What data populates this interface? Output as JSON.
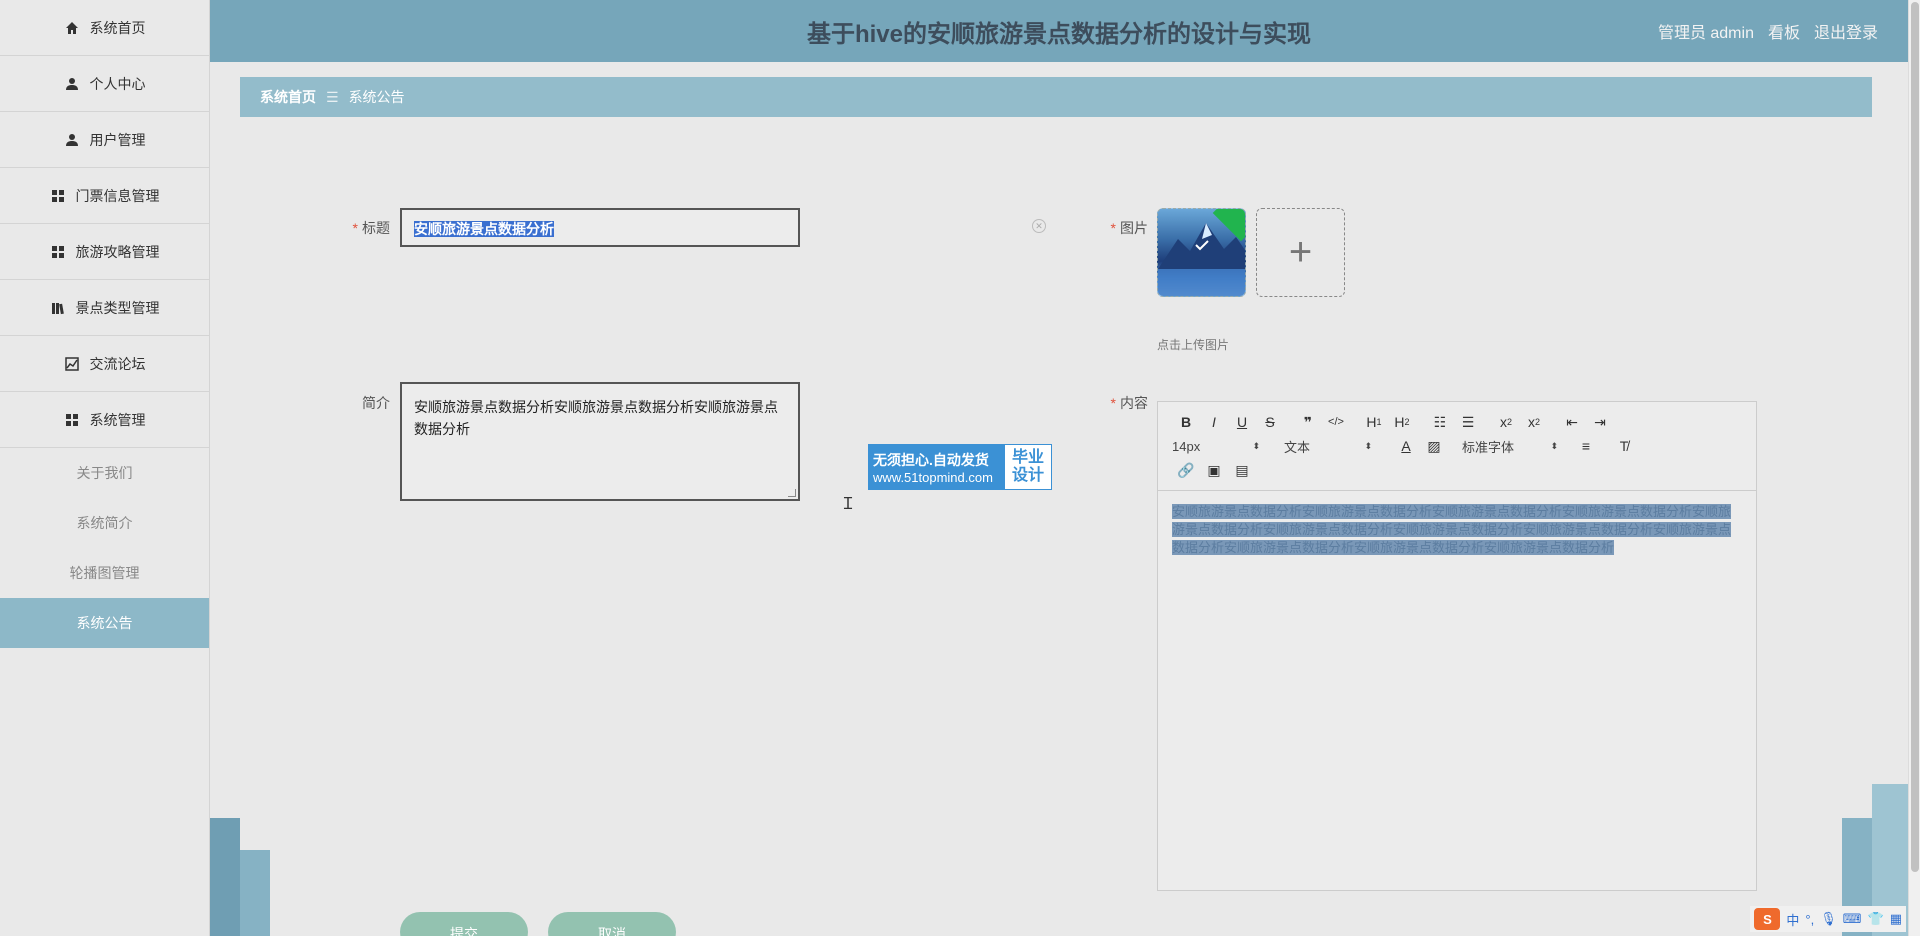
{
  "sidebar": {
    "items": [
      {
        "label": "系统首页",
        "icon": "home-icon"
      },
      {
        "label": "个人中心",
        "icon": "user-icon"
      },
      {
        "label": "用户管理",
        "icon": "user-icon"
      },
      {
        "label": "门票信息管理",
        "icon": "grid-icon"
      },
      {
        "label": "旅游攻略管理",
        "icon": "grid-icon"
      },
      {
        "label": "景点类型管理",
        "icon": "books-icon"
      },
      {
        "label": "交流论坛",
        "icon": "chart-icon"
      },
      {
        "label": "系统管理",
        "icon": "grid-icon"
      }
    ],
    "sub_items": [
      {
        "label": "关于我们"
      },
      {
        "label": "系统简介"
      },
      {
        "label": "轮播图管理"
      },
      {
        "label": "系统公告",
        "active": true
      }
    ]
  },
  "header": {
    "title": "基于hive的安顺旅游景点数据分析的设计与实现",
    "admin": "管理员 admin",
    "board": "看板",
    "logout": "退出登录"
  },
  "breadcrumb": {
    "home": "系统首页",
    "sep": "☰",
    "current": "系统公告"
  },
  "form": {
    "title_label": "标题",
    "title_value": "安顺旅游景点数据分析",
    "summary_label": "简介",
    "summary_value": "安顺旅游景点数据分析安顺旅游景点数据分析安顺旅游景点数据分析",
    "image_label": "图片",
    "upload_hint": "点击上传图片",
    "content_label": "内容",
    "content_value": "安顺旅游景点数据分析安顺旅游景点数据分析安顺旅游景点数据分析安顺旅游景点数据分析安顺旅游景点数据分析安顺旅游景点数据分析安顺旅游景点数据分析安顺旅游景点数据分析安顺旅游景点数据分析安顺旅游景点数据分析安顺旅游景点数据分析安顺旅游景点数据分析",
    "submit": "提交",
    "cancel": "取消"
  },
  "editor": {
    "font_size": "14px",
    "header_type": "文本",
    "font_family": "标准字体"
  },
  "ad": {
    "line1": "无须担心.自动发货",
    "line2": "www.51topmind.com",
    "badge1": "毕业",
    "badge2": "设计"
  },
  "ime": {
    "logo": "S",
    "lang": "中"
  }
}
